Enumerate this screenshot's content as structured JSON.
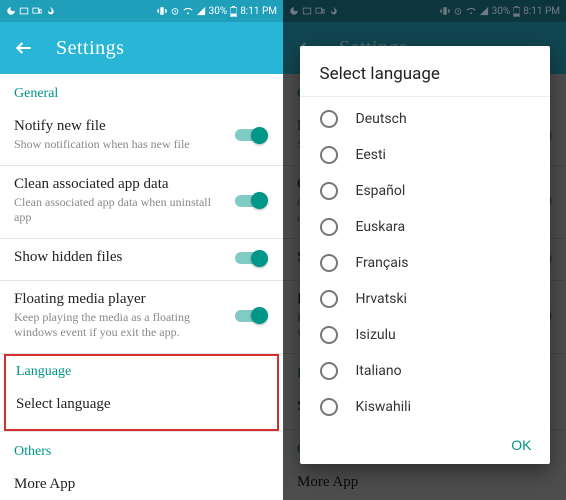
{
  "status": {
    "battery": "30%",
    "time": "8:11 PM"
  },
  "appbar": {
    "title": "Settings"
  },
  "sections": {
    "general": "General",
    "language": "Language",
    "others": "Others"
  },
  "settings": {
    "notify": {
      "title": "Notify new file",
      "sub": "Show notification when has new file"
    },
    "clean": {
      "title": "Clean associated app data",
      "sub": "Clean associated app data when uninstall app"
    },
    "hidden": {
      "title": "Show hidden files"
    },
    "float": {
      "title": "Floating media player",
      "sub": "Keep playing the media as a floating windows event if you exit the app."
    },
    "selectLang": {
      "title": "Select language"
    },
    "moreApp": {
      "title": "More App"
    }
  },
  "dialog": {
    "title": "Select language",
    "options": {
      "0": "Deutsch",
      "1": "Eesti",
      "2": "Español",
      "3": "Euskara",
      "4": "Français",
      "5": "Hrvatski",
      "6": "Isizulu",
      "7": "Italiano",
      "8": "Kiswahili"
    },
    "ok": "OK"
  }
}
